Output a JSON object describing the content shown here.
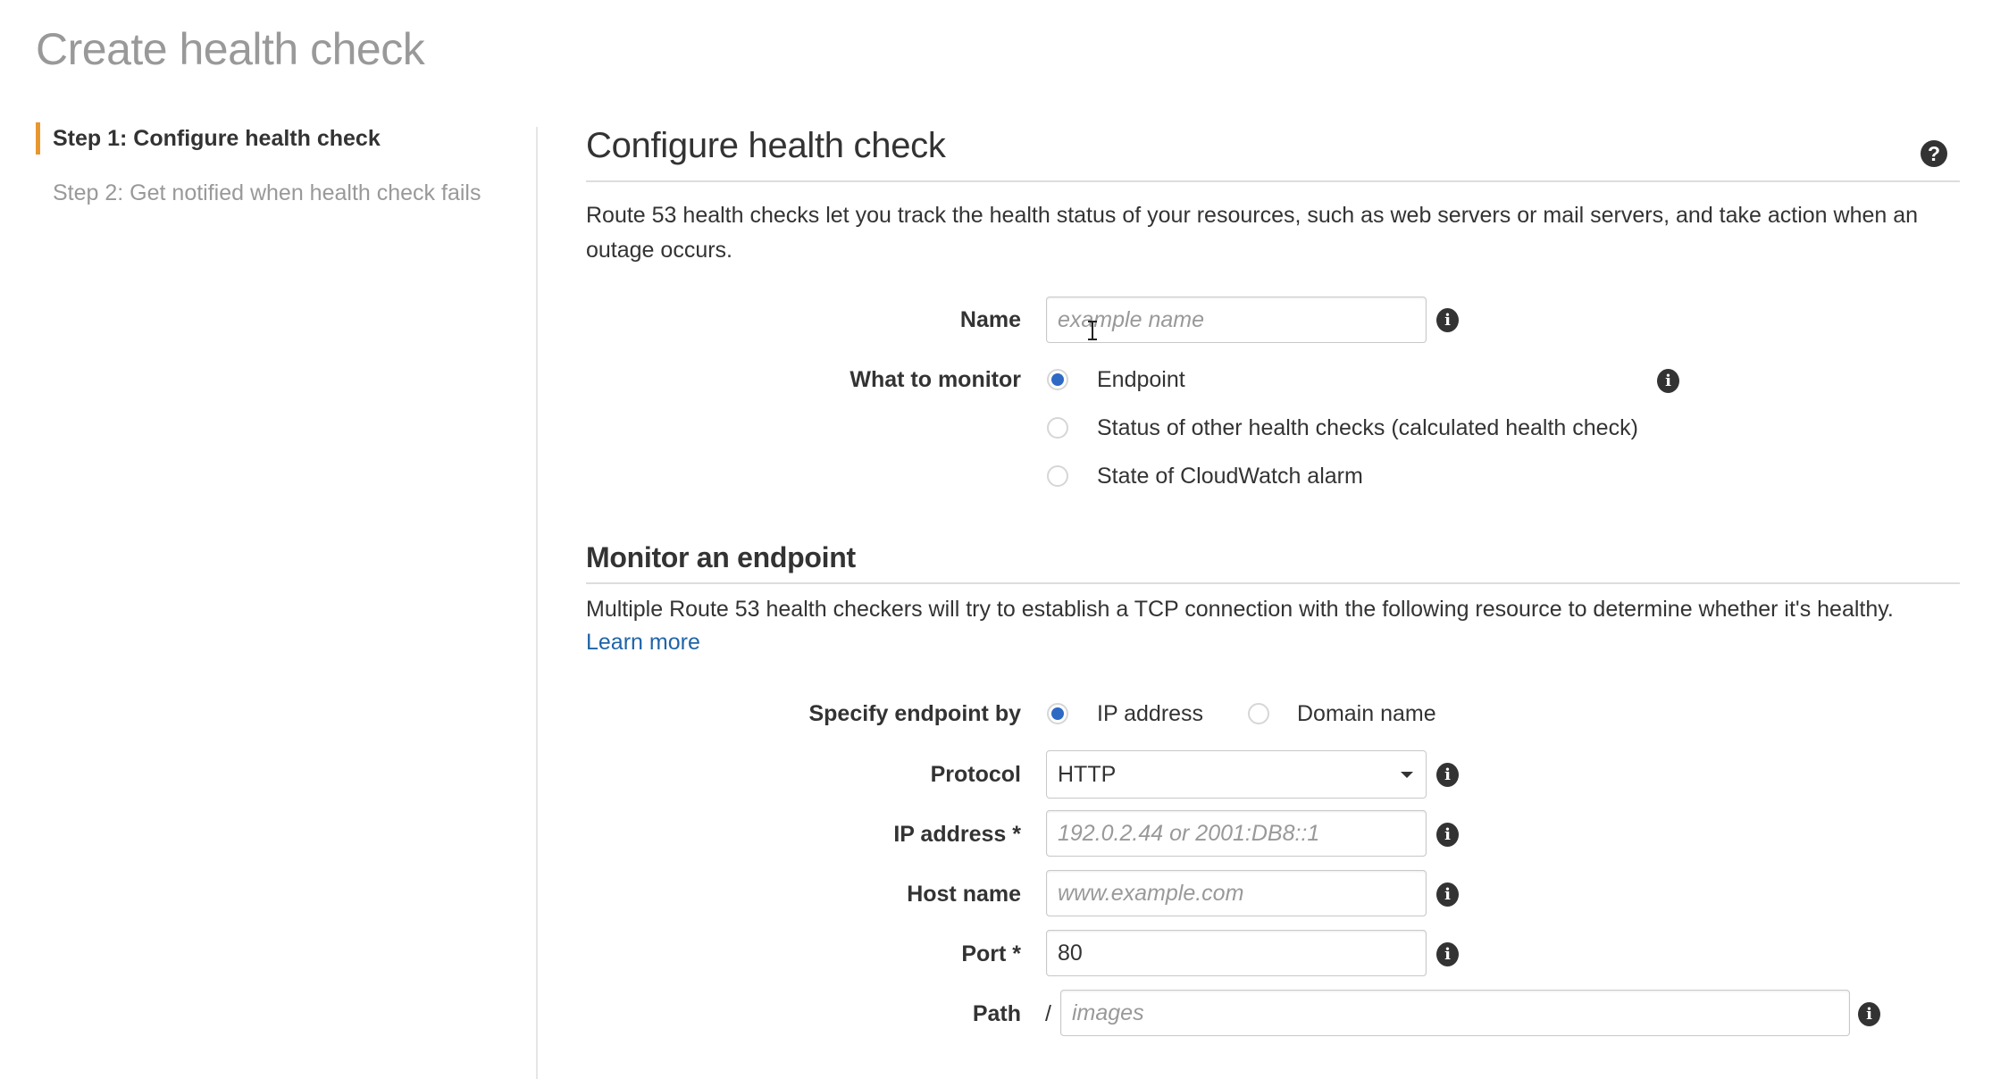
{
  "page": {
    "title": "Create health check"
  },
  "sidebar": {
    "steps": [
      {
        "label": "Step 1: Configure health check",
        "active": true
      },
      {
        "label": "Step 2: Get notified when health check fails",
        "active": false
      }
    ],
    "accent_color": "#e7972e"
  },
  "configure": {
    "title": "Configure health check",
    "help_icon": "question-circle-icon",
    "description": "Route 53 health checks let you track the health status of your resources, such as web servers or mail servers, and take action when an outage occurs.",
    "name": {
      "label": "Name",
      "value": "",
      "placeholder": "example name"
    },
    "what_to_monitor": {
      "label": "What to monitor",
      "options": [
        {
          "label": "Endpoint",
          "selected": true
        },
        {
          "label": "Status of other health checks (calculated health check)",
          "selected": false
        },
        {
          "label": "State of CloudWatch alarm",
          "selected": false
        }
      ]
    }
  },
  "endpoint": {
    "title": "Monitor an endpoint",
    "description": "Multiple Route 53 health checkers will try to establish a TCP connection with the following resource to determine whether it's healthy.",
    "learn_more": "Learn more",
    "specify_by": {
      "label": "Specify endpoint by",
      "options": [
        {
          "label": "IP address",
          "selected": true
        },
        {
          "label": "Domain name",
          "selected": false
        }
      ]
    },
    "protocol": {
      "label": "Protocol",
      "value": "HTTP"
    },
    "ip_address": {
      "label": "IP address *",
      "value": "",
      "placeholder": "192.0.2.44 or 2001:DB8::1"
    },
    "host_name": {
      "label": "Host name",
      "value": "",
      "placeholder": "www.example.com"
    },
    "port": {
      "label": "Port *",
      "value": "80"
    },
    "path": {
      "label": "Path",
      "prefix": "/",
      "value": "",
      "placeholder": "images"
    }
  },
  "icons": {
    "info": "i",
    "help": "?"
  },
  "colors": {
    "radio_selected": "#2e6ac4",
    "link": "#1f64a8"
  }
}
